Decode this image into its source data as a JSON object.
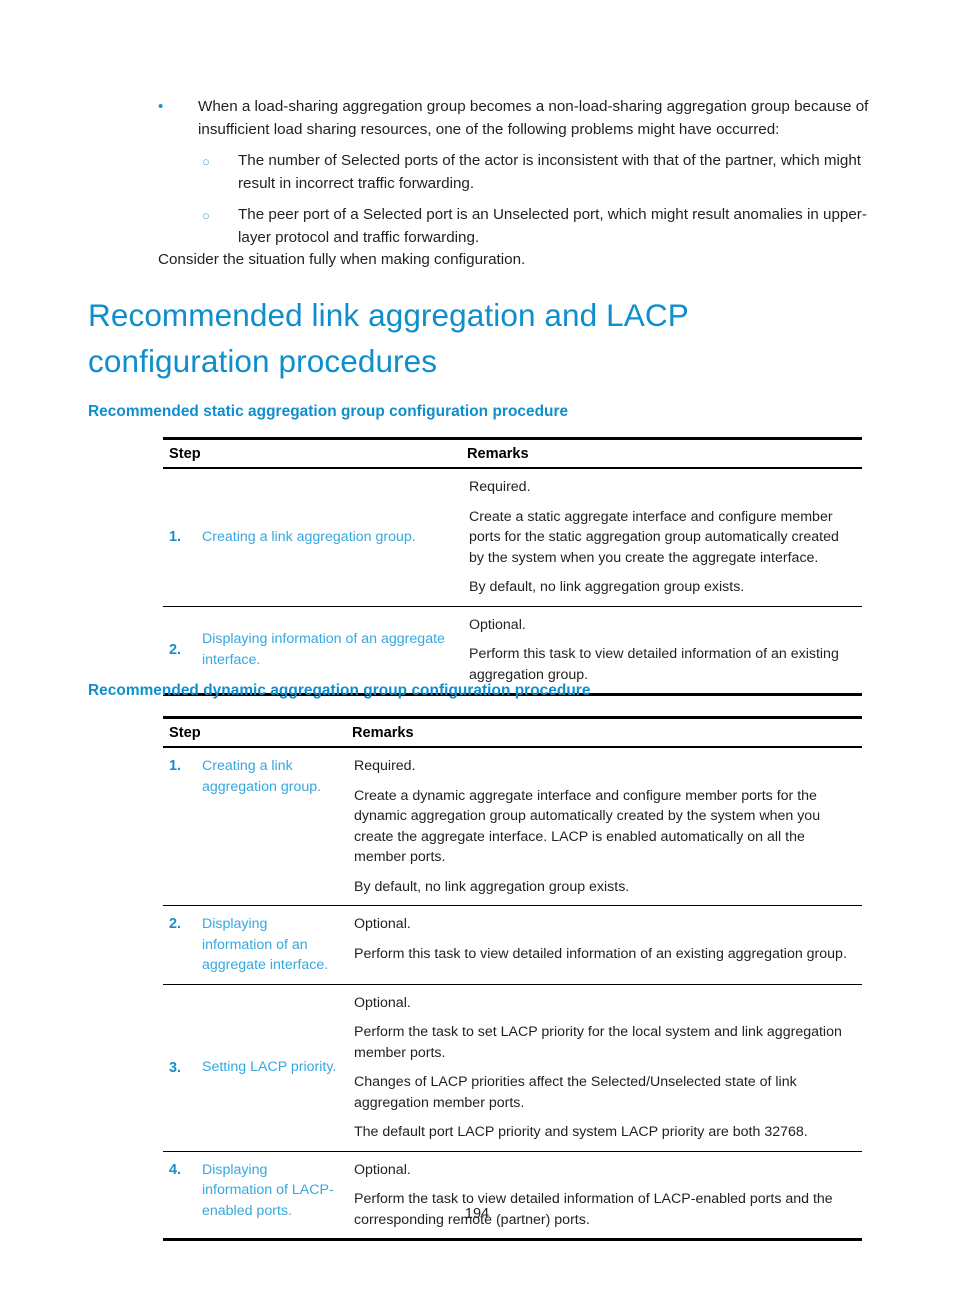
{
  "intro": {
    "bullets": [
      {
        "marker": "•",
        "text": "When a load-sharing aggregation group becomes a non-load-sharing aggregation group because of insufficient load sharing resources, one of the following problems might have occurred:",
        "sub_bullets": [
          {
            "marker": "○",
            "text": "The number of Selected ports of the actor is inconsistent with that of the partner, which might result in incorrect traffic forwarding."
          },
          {
            "marker": "○",
            "text": "The peer port of a Selected port is an Unselected port, which might result anomalies in upper-layer protocol and traffic forwarding."
          }
        ]
      }
    ],
    "closing_paragraph": "Consider the situation fully when making configuration."
  },
  "heading": {
    "title": "Recommended link aggregation and LACP configuration procedures"
  },
  "sections": [
    {
      "subheading": "Recommended static aggregation group configuration procedure",
      "table": {
        "columns": [
          "Step",
          "Remarks"
        ],
        "rows": [
          {
            "number": "1.",
            "step_link": "Creating a link aggregation group.",
            "remarks": [
              "Required.",
              "Create a static aggregate interface and configure member ports for the static aggregation group automatically created by the system when you create the aggregate interface.",
              "By default, no link aggregation group exists."
            ]
          },
          {
            "number": "2.",
            "step_link": "Displaying information of an aggregate interface.",
            "remarks": [
              "Optional.",
              "Perform this task to view detailed information of an existing aggregation group."
            ]
          }
        ]
      }
    },
    {
      "subheading": "Recommended dynamic aggregation group configuration procedure",
      "table": {
        "columns": [
          "Step",
          "Remarks"
        ],
        "rows": [
          {
            "number": "1.",
            "step_link": "Creating a link aggregation group.",
            "remarks": [
              "Required.",
              "Create a dynamic aggregate interface and configure member ports for the dynamic aggregation group automatically created by the system when you create the aggregate interface. LACP is enabled automatically on all the member ports.",
              "By default, no link aggregation group exists."
            ]
          },
          {
            "number": "2.",
            "step_link": "Displaying information of an aggregate interface.",
            "remarks": [
              "Optional.",
              "Perform this task to view detailed information of an existing aggregation group."
            ]
          },
          {
            "number": "3.",
            "step_link": "Setting LACP priority.",
            "remarks": [
              "Optional.",
              "Perform the task to set LACP priority for the local system and link aggregation member ports.",
              "Changes of LACP priorities affect the Selected/Unselected state of link aggregation member ports.",
              "The default port LACP priority and system LACP priority are both 32768."
            ]
          },
          {
            "number": "4.",
            "step_link": "Displaying information of LACP-enabled ports.",
            "remarks": [
              "Optional.",
              "Perform the task to view detailed information of LACP-enabled ports and the corresponding remote (partner) ports."
            ]
          }
        ]
      }
    }
  ],
  "footer": {
    "page_number": "194"
  },
  "colors": {
    "heading_blue": "#0f8ecd",
    "link_blue": "#35a8e0",
    "step_number_blue": "#1b8dc6",
    "body_text": "#231f20"
  }
}
